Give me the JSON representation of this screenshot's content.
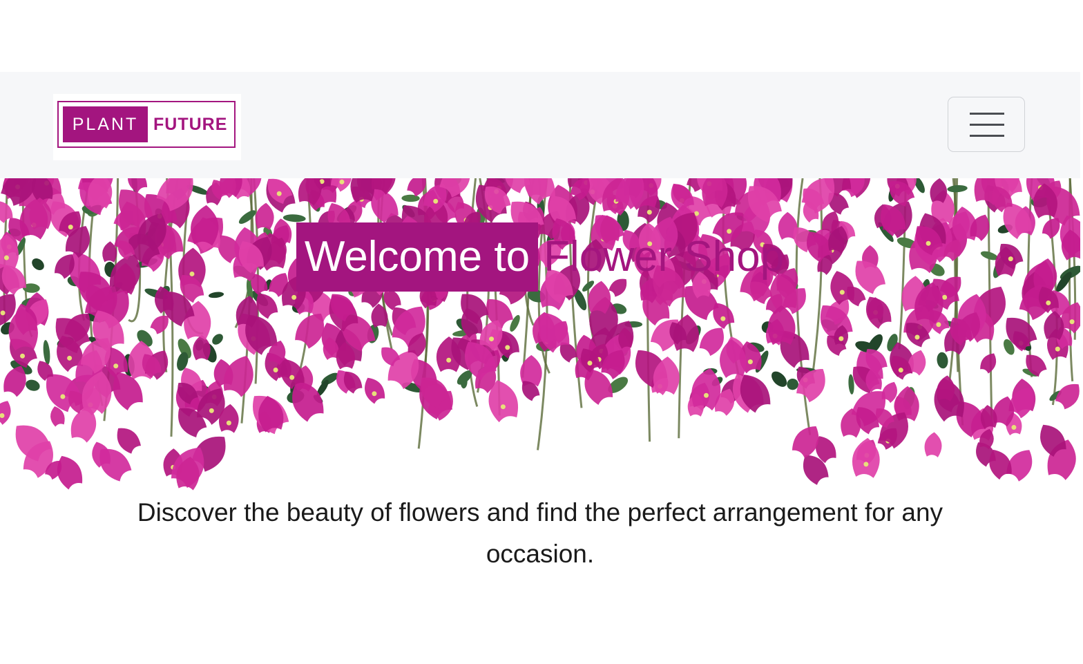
{
  "navbar": {
    "logo": {
      "word1": "PLANT",
      "word2": "FUTURE"
    },
    "menu_toggle_icon": "hamburger-menu-icon"
  },
  "hero": {
    "background_image": "pink-bougainvillea-flowers",
    "title_highlight": "Welcome to",
    "title_rest": "Flower Shop",
    "subtitle": "Discover the beauty of flowers and find the perfect arrangement for any occasion."
  },
  "colors": {
    "brand": "#a3157f",
    "navbar_bg": "#f6f7f9",
    "flower_pink": "#c8208f",
    "leaf_green": "#2e5a36"
  }
}
